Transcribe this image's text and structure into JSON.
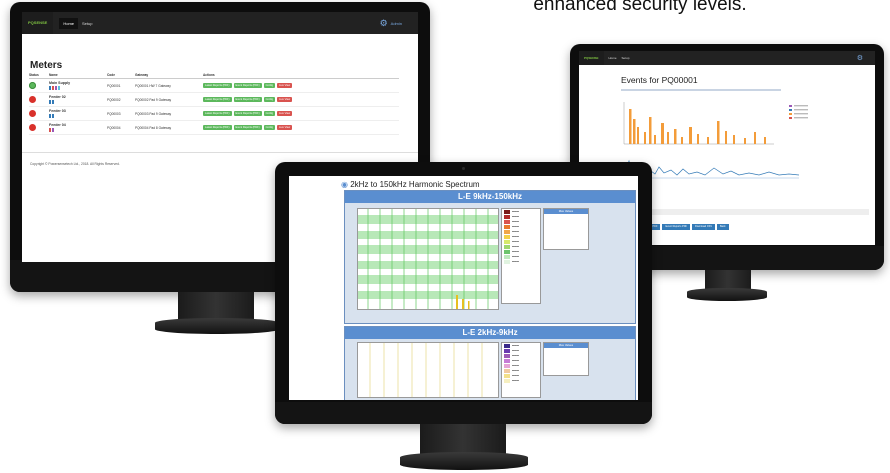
{
  "caption": "enhanced security levels.",
  "meters_app": {
    "logo": "PQSENSE",
    "nav": [
      "Home",
      "Setup"
    ],
    "user": "Admin",
    "page_title": "Meters",
    "columns": [
      "Status",
      "Name",
      "Code",
      "Gateway",
      "Actions"
    ],
    "rows": [
      {
        "status": "ok",
        "name": "Main Supply",
        "code": "PQ00001",
        "gateway": "PQ00001 HW 7 Gateway"
      },
      {
        "status": "alarm",
        "name": "Feeder 02",
        "code": "PQ00002",
        "gateway": "PQ00002 Pad 9 Gateway"
      },
      {
        "status": "alarm",
        "name": "Feeder 03",
        "code": "PQ00003",
        "gateway": "PQ00003 Pad 9 Gateway"
      },
      {
        "status": "alarm",
        "name": "Feeder 04",
        "code": "PQ00004",
        "gateway": "PQ00004 Pad 8 Gateway"
      }
    ],
    "action_labels": [
      "Latest Reports (PDF)",
      "Event Reports (PDF)",
      "Config",
      "Live View"
    ],
    "footer": "Copyright © Powersensetech Ltd., 2018. All Rights Reserved.",
    "colors": {
      "ok": "#5cb85c",
      "alarm": "#d9312b",
      "header": "#222222"
    }
  },
  "harmonic_app": {
    "title": "2kHz to 150kHz Harmonic Spectrum",
    "panel1_title": "L-E 9kHz-150kHz",
    "panel2_title": "L-E 2kHz-9kHz",
    "stats_head": "Max Values"
  },
  "events_app": {
    "logo": "PQSENSE",
    "nav": [
      "Home",
      "Setup"
    ],
    "title": "Events for PQ00001",
    "export_button": "Export",
    "bottom_buttons": [
      "Live View",
      "Download PDF",
      "Event Reports PDF",
      "Download CSV",
      "Back"
    ]
  }
}
